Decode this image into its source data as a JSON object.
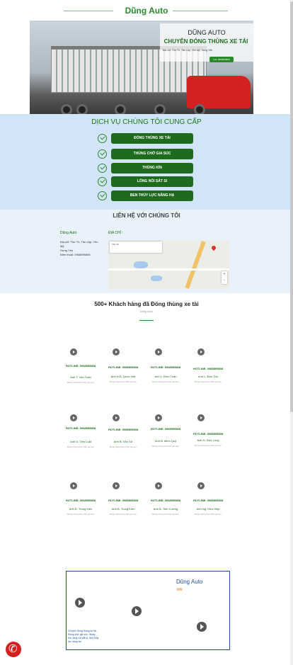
{
  "header": {
    "brand": "Dũng Auto"
  },
  "hero": {
    "title": "DŨNG AUTO",
    "subtitle": "CHUYÊN ĐÓNG THÙNG XE TẢI",
    "address": "Địa chỉ: Thư Trì, Tân Lập, Yên Mỹ, Hưng Yên",
    "button": "Gọi: 0968595808"
  },
  "services": {
    "title": "DỊCH VỤ CHÚNG TÔI CUNG CẤP",
    "items": [
      {
        "label": "ĐÓNG THÙNG XE TẢI"
      },
      {
        "label": "THÙNG CHỞ GIA SÚC"
      },
      {
        "label": "THÙNG KÍN"
      },
      {
        "label": "LỒNG NỐI SẮT SI"
      },
      {
        "label": "BEN THỦY LỰC NÂNG HẠ"
      }
    ]
  },
  "contact": {
    "title": "LIÊN HỆ VỚI CHÚNG TÔI",
    "name": "Dũng Auto",
    "address_lines": [
      "Địa chỉ: Thư Trì, Tân Lập, Yên Mỹ,",
      "Hưng Yên",
      "Điện thoại: 0968595808"
    ],
    "map_label": "ĐỊA CHỈ :",
    "map_card": "Thư Trì",
    "map_zoom_in": "+",
    "map_zoom_out": "−"
  },
  "customers": {
    "title": "500+ Khách hàng đã Đóng thùng xe tải",
    "subtitle": "Dũng Auto",
    "hotline": "HOTLINE: 0968595808",
    "desc": "Đóng thùng bàn chở gia súc",
    "rows": [
      [
        "Anh T. Văn Tuấn",
        "Anh N.Đ. Quốc Việt",
        "Anh L. Đình Tuấn",
        "Anh L. Đức Thọ"
      ],
      [
        "Anh D. Tiến Luật",
        "Anh B. Văn Sử",
        "Anh B. Minh Quý",
        "Anh H. Đức Long"
      ],
      [
        "Anh Đ. Trung Kiên",
        "Anh B. Trung Kiên",
        "Anh B. Tiến Cường",
        "Anh Ng. Hữu Hiệp"
      ]
    ]
  },
  "bottom_box": {
    "name": "Dũng Auto",
    "wave": "≋≋",
    "desc": "Chuyên đóng thùng xe tải, thùng chở gia súc, thùng kín, lồng nối sắt si, ben thủy lực nâng hạ"
  },
  "colors": {
    "accent_green": "#2a8a2a",
    "button_green": "#1e6b1e",
    "services_bg": "#d2e4f8",
    "contact_bg": "#e9f1fb",
    "phone_red": "#d62020"
  }
}
